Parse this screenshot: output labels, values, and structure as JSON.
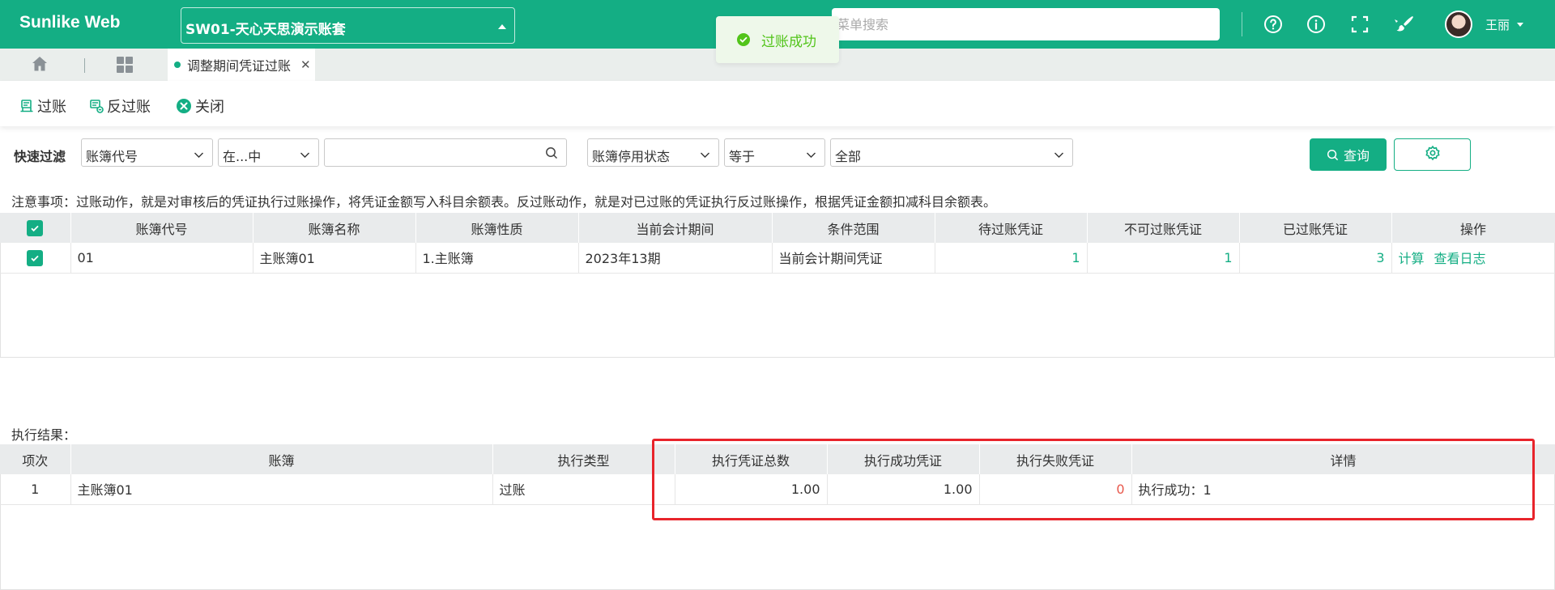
{
  "header": {
    "app_name": "Sunlike Web",
    "account_set": "SW01-天心天思演示账套",
    "search_placeholder": "菜单搜索",
    "user_name": "王丽"
  },
  "toast": {
    "message": "过账成功"
  },
  "tabs": {
    "active_label": "调整期间凭证过账"
  },
  "toolbar": {
    "post_label": "过账",
    "unpost_label": "反过账",
    "close_label": "关闭"
  },
  "filter": {
    "label": "快速过滤",
    "field1": "账簿代号",
    "operator1": "在...中",
    "value1": "",
    "field2": "账簿停用状态",
    "operator2": "等于",
    "value2": "全部",
    "query_label": "查询"
  },
  "notice": "注意事项：过账动作，就是对审核后的凭证执行过账操作，将凭证金额写入科目余额表。反过账动作，就是对已过账的凭证执行反过账操作，根据凭证金额扣减科目余额表。",
  "ledger_table": {
    "headers": [
      "账簿代号",
      "账簿名称",
      "账簿性质",
      "当前会计期间",
      "条件范围",
      "待过账凭证",
      "不可过账凭证",
      "已过账凭证",
      "操作"
    ],
    "rows": [
      {
        "code": "01",
        "name": "主账簿01",
        "nature": "1.主账簿",
        "period": "2023年13期",
        "scope": "当前会计期间凭证",
        "pending": "1",
        "unpostable": "1",
        "posted": "3",
        "op_calc": "计算",
        "op_log": "查看日志"
      }
    ]
  },
  "result_label": "执行结果：",
  "result_table": {
    "headers": [
      "项次",
      "账簿",
      "执行类型",
      "执行凭证总数",
      "执行成功凭证",
      "执行失败凭证",
      "详情"
    ],
    "rows": [
      {
        "index": "1",
        "ledger": "主账簿01",
        "type": "过账",
        "total": "1.00",
        "success": "1.00",
        "failed": "0",
        "detail": "执行成功：1"
      }
    ]
  },
  "colors": {
    "brand": "#14ae84",
    "toast_bg": "#eef8ea",
    "toast_text": "#52c41a",
    "fail_red": "#e8574b",
    "highlight": "#e8242b"
  }
}
